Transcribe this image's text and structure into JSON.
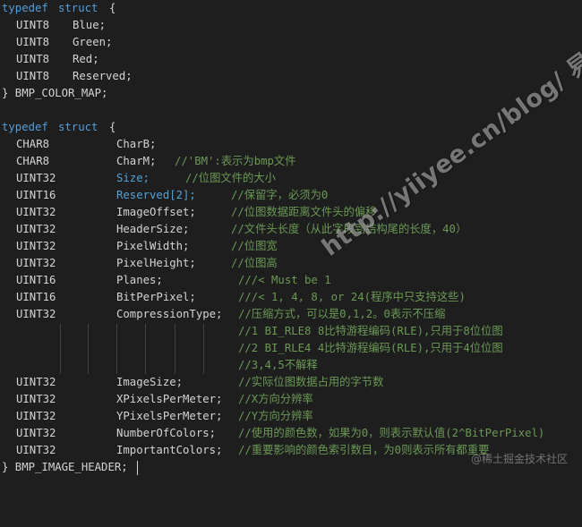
{
  "struct1": {
    "open": {
      "kw1": "typedef",
      "kw2": "struct",
      "brace": "{"
    },
    "fields": [
      {
        "type": "UINT8",
        "name": "Blue;"
      },
      {
        "type": "UINT8",
        "name": "Green;"
      },
      {
        "type": "UINT8",
        "name": "Red;"
      },
      {
        "type": "UINT8",
        "name": "Reserved;"
      }
    ],
    "close": "} BMP_COLOR_MAP;"
  },
  "struct2": {
    "open": {
      "kw1": "typedef",
      "kw2": "struct",
      "brace": "{"
    },
    "fields": [
      {
        "type": "CHAR8",
        "name": "CharB;",
        "comment": ""
      },
      {
        "type": "CHAR8",
        "name": "CharM;",
        "comment": "//'BM':表示为bmp文件"
      },
      {
        "type": "UINT32",
        "name": "Size;",
        "comment": "//位图文件的大小"
      },
      {
        "type": "UINT16",
        "name": "Reserved[2];",
        "comment": "//保留字，必须为0"
      },
      {
        "type": "UINT32",
        "name": "ImageOffset;",
        "comment": "//位图数据距离文件头的偏移"
      },
      {
        "type": "UINT32",
        "name": "HeaderSize;",
        "comment": "//文件头长度（从此字段到结构尾的长度，40）"
      },
      {
        "type": "UINT32",
        "name": "PixelWidth;",
        "comment": "//位图宽"
      },
      {
        "type": "UINT32",
        "name": "PixelHeight;",
        "comment": "//位图高"
      },
      {
        "type": "UINT16",
        "name": "Planes;",
        "comment": "///< Must be 1"
      },
      {
        "type": "UINT16",
        "name": "BitPerPixel;",
        "comment": "///< 1, 4, 8, or 24(程序中只支持这些)"
      },
      {
        "type": "UINT32",
        "name": "CompressionType;",
        "comment": "//压缩方式，可以是0,1,2。0表示不压缩"
      },
      {
        "type": "",
        "name": "",
        "comment": "//1 BI_RLE8 8比特游程编码(RLE),只用于8位位图"
      },
      {
        "type": "",
        "name": "",
        "comment": "//2 BI_RLE4 4比特游程编码(RLE),只用于4位位图"
      },
      {
        "type": "",
        "name": "",
        "comment": "//3,4,5不解释"
      },
      {
        "type": "UINT32",
        "name": "ImageSize;",
        "comment": "//实际位图数据占用的字节数"
      },
      {
        "type": "UINT32",
        "name": "XPixelsPerMeter;",
        "comment": "//X方向分辨率"
      },
      {
        "type": "UINT32",
        "name": "YPixelsPerMeter;",
        "comment": "//Y方向分辨率"
      },
      {
        "type": "UINT32",
        "name": "NumberOfColors;",
        "comment": "//使用的颜色数，如果为0，则表示默认值(2^BitPerPixel)"
      },
      {
        "type": "UINT32",
        "name": "ImportantColors;",
        "comment": "//重要影响的颜色索引数目，为0则表示所有都重要"
      }
    ],
    "close": "} BMP_IMAGE_HEADER;"
  },
  "watermark": {
    "text": "http://yiiyee.cn/blog/ 易鱼-罗冰(Robin)",
    "footer": "@稀土掘金技术社区"
  },
  "colors": {
    "background": "#1e1e1e",
    "keyword": "#569cd6",
    "comment": "#6a9955",
    "text": "#d4d4d4"
  }
}
